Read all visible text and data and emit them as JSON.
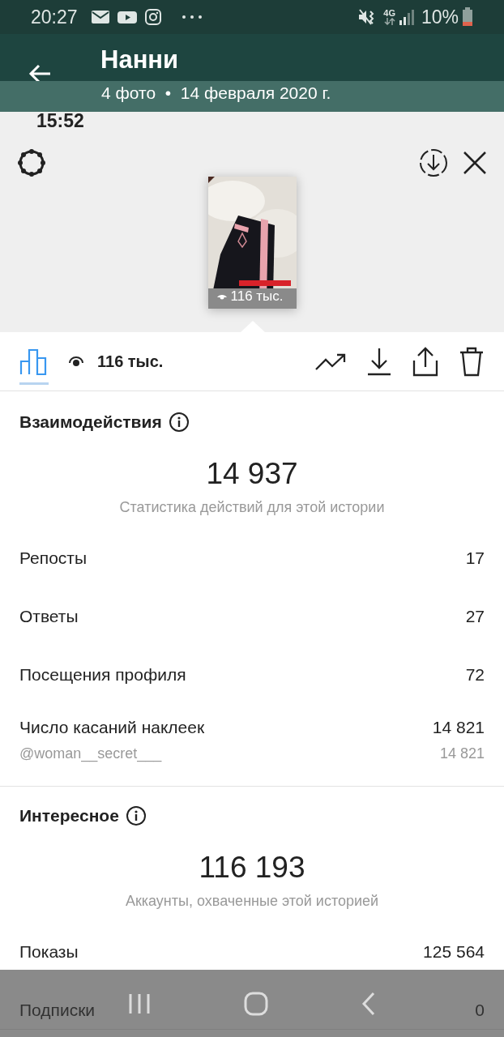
{
  "status_bar": {
    "time": "20:27",
    "network": "4G",
    "battery": "10%"
  },
  "header": {
    "title": "Нанни",
    "subtitle": "4 фото  •  14 февраля 2020 г."
  },
  "story": {
    "status_time": "15:52",
    "views_overlay": "116 тыс."
  },
  "toolbar": {
    "tabs": [
      {
        "kind": "insights",
        "selected": true
      }
    ],
    "views": "116 тыс."
  },
  "sections": [
    {
      "title": "Взаимодействия",
      "total": "14 937",
      "caption": "Статистика действий для этой истории",
      "rows": [
        {
          "kind": "main",
          "label": "Репосты",
          "value": "17"
        },
        {
          "kind": "main",
          "label": "Ответы",
          "value": "27"
        },
        {
          "kind": "main",
          "label": "Посещения профиля",
          "value": "72"
        },
        {
          "kind": "main",
          "label": "Число касаний наклеек",
          "value": "14 821"
        },
        {
          "kind": "sub",
          "label": "@woman__secret___",
          "value": "14 821"
        }
      ]
    },
    {
      "title": "Интересное",
      "total": "116 193",
      "caption": "Аккаунты, охваченные этой историей",
      "rows": [
        {
          "kind": "main",
          "label": "Показы",
          "value": "125 564"
        },
        {
          "kind": "main",
          "label": "Подписки",
          "value": "0"
        }
      ]
    }
  ]
}
